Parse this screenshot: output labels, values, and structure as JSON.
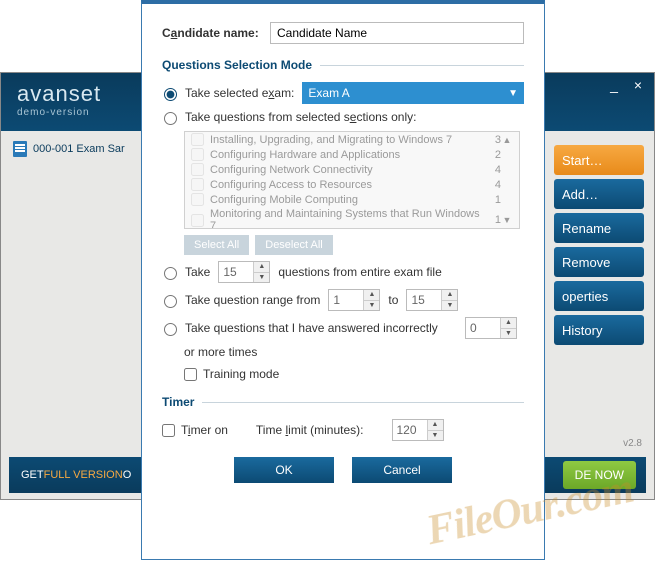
{
  "bg": {
    "logo_main": "avanset",
    "logo_sub": "demo-version",
    "file_item": "000-001 Exam Sar",
    "buttons": {
      "start": "Start…",
      "add": "Add…",
      "rename": "Rename",
      "remove": "Remove",
      "properties": "operties",
      "history": "History"
    },
    "version": "v2.8",
    "footer_pre": "GET ",
    "footer_orange": "FULL VERSION",
    "footer_post": " O",
    "upgrade": "DE NOW"
  },
  "dialog": {
    "candidate_label_pre": "C",
    "candidate_label_u": "a",
    "candidate_label_post": "ndidate name:",
    "candidate_value": "Candidate Name",
    "qsm_header": "Questions Selection Mode",
    "opt_selected_pre": "Take selected e",
    "opt_selected_u": "x",
    "opt_selected_post": "am:",
    "exam_dropdown": "Exam A",
    "opt_sections_pre": "Take questions from selected s",
    "opt_sections_u": "e",
    "opt_sections_post": "ctions only:",
    "sections": [
      {
        "label": "Installing, Upgrading, and Migrating to Windows 7",
        "count": 3
      },
      {
        "label": "Configuring Hardware and Applications",
        "count": 2
      },
      {
        "label": "Configuring Network Connectivity",
        "count": 4
      },
      {
        "label": "Configuring Access to Resources",
        "count": 4
      },
      {
        "label": "Configuring Mobile Computing",
        "count": 1
      },
      {
        "label": "Monitoring and Maintaining Systems that Run Windows 7",
        "count": 1
      }
    ],
    "select_all": "Select All",
    "deselect_all": "Deselect All",
    "opt_take_pre": "Take",
    "opt_take_count": "15",
    "opt_take_post": "questions from entire exam file",
    "opt_range_pre": "Take question range from",
    "opt_range_from": "1",
    "opt_range_to_lbl": "to",
    "opt_range_to": "15",
    "opt_incorrect": "Take questions that I have answered incorrectly",
    "opt_incorrect_val": "0",
    "opt_incorrect_post": "or more times",
    "training_mode": "Training mode",
    "timer_header": "Timer",
    "timer_on_pre": "T",
    "timer_on_u": "i",
    "timer_on_post": "mer on",
    "time_limit_pre": "Time ",
    "time_limit_u": "l",
    "time_limit_post": "imit (minutes):",
    "time_limit_val": "120",
    "ok": "OK",
    "cancel": "Cancel"
  },
  "watermark": "FileOur.com"
}
